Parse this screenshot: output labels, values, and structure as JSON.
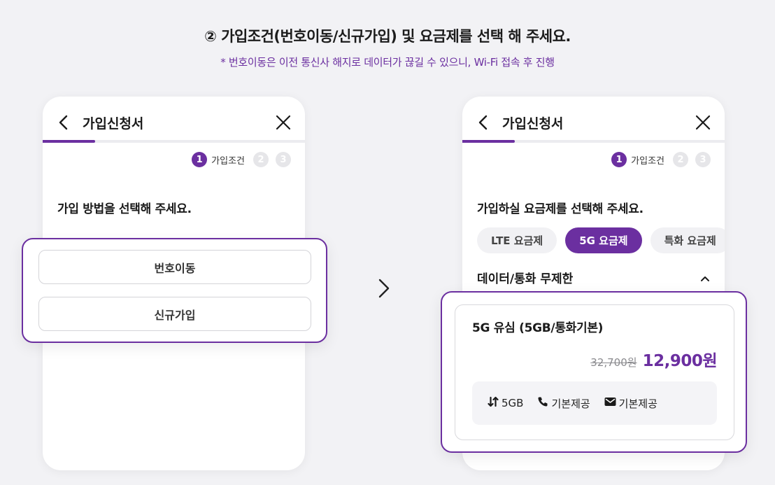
{
  "heading": "② 가입조건(번호이동/신규가입) 및 요금제를 선택 해 주세요.",
  "subheading": "* 번호이동은 이전 통신사 해지로 데이터가 끊길 수 있으니, Wi-Fi 접속 후 진행",
  "colors": {
    "accent": "#6b2fa0",
    "background": "#f2f2f5"
  },
  "left_phone": {
    "title": "가입신청서",
    "progress": 0.2,
    "steps": {
      "step1": "1",
      "step1_label": "가입조건",
      "step2": "2",
      "step3": "3"
    },
    "question": "가입 방법을 선택해 주세요.",
    "options": [
      "번호이동",
      "신규가입"
    ]
  },
  "right_phone": {
    "title": "가입신청서",
    "progress": 0.2,
    "steps": {
      "step1": "1",
      "step1_label": "가입조건",
      "step2": "2",
      "step3": "3"
    },
    "question": "가입하실 요금제를 선택해 주세요.",
    "tabs": [
      {
        "label": "LTE 요금제",
        "active": false
      },
      {
        "label": "5G 요금제",
        "active": true
      },
      {
        "label": "특화 요금제",
        "active": false
      }
    ],
    "category": "데이터/통화 무제한",
    "plan": {
      "name": "5G 유심 (5GB/통화기본)",
      "original_price": "32,700원",
      "price": "12,900원",
      "features": [
        {
          "icon": "data-arrows-icon",
          "label": "5GB"
        },
        {
          "icon": "phone-icon",
          "label": "기본제공"
        },
        {
          "icon": "mail-icon",
          "label": "기본제공"
        }
      ]
    }
  }
}
